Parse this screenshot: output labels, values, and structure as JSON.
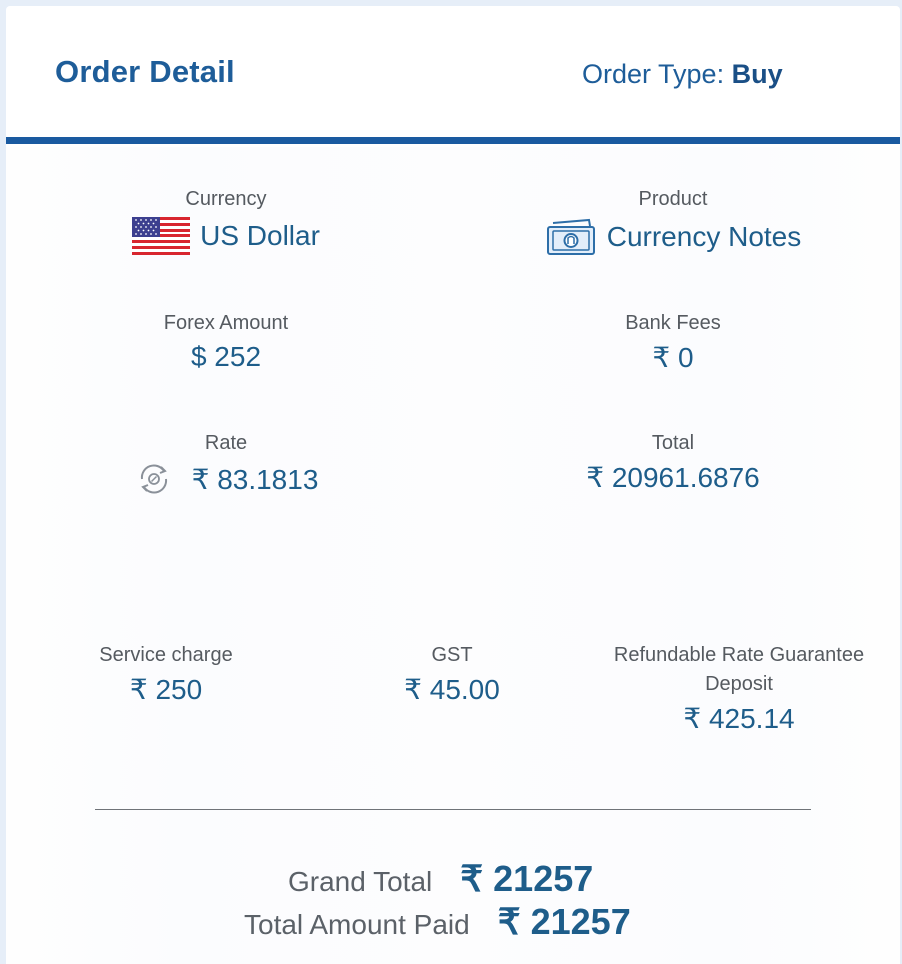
{
  "header": {
    "title": "Order Detail",
    "order_type_label": "Order Type:",
    "order_type_value": "Buy"
  },
  "fields": {
    "currency": {
      "label": "Currency",
      "value": "US Dollar",
      "icon": "us-flag-icon"
    },
    "product": {
      "label": "Product",
      "value": "Currency Notes",
      "icon": "currency-notes-icon"
    },
    "forex_amount": {
      "label": "Forex Amount",
      "value": "$ 252"
    },
    "bank_fees": {
      "label": "Bank Fees",
      "value": "₹ 0"
    },
    "rate": {
      "label": "Rate",
      "value": "₹ 83.1813",
      "icon": "rate-refresh-icon"
    },
    "total": {
      "label": "Total",
      "value": "₹ 20961.6876"
    },
    "service_charge": {
      "label": "Service charge",
      "value": "₹ 250"
    },
    "gst": {
      "label": "GST",
      "value": "₹ 45.00"
    },
    "refundable_deposit": {
      "label_line1": "Refundable Rate Guarantee",
      "label_line2": "Deposit",
      "value": "₹ 425.14"
    }
  },
  "summary": {
    "grand_total_label": "Grand Total",
    "grand_total_value": "₹ 21257",
    "total_paid_label": "Total Amount Paid",
    "total_paid_value": "₹ 21257"
  },
  "colors": {
    "accent": "#1a5aa0",
    "text_value": "#1e5d8a",
    "text_label": "#555a60",
    "page_bg": "#e6eef8"
  }
}
